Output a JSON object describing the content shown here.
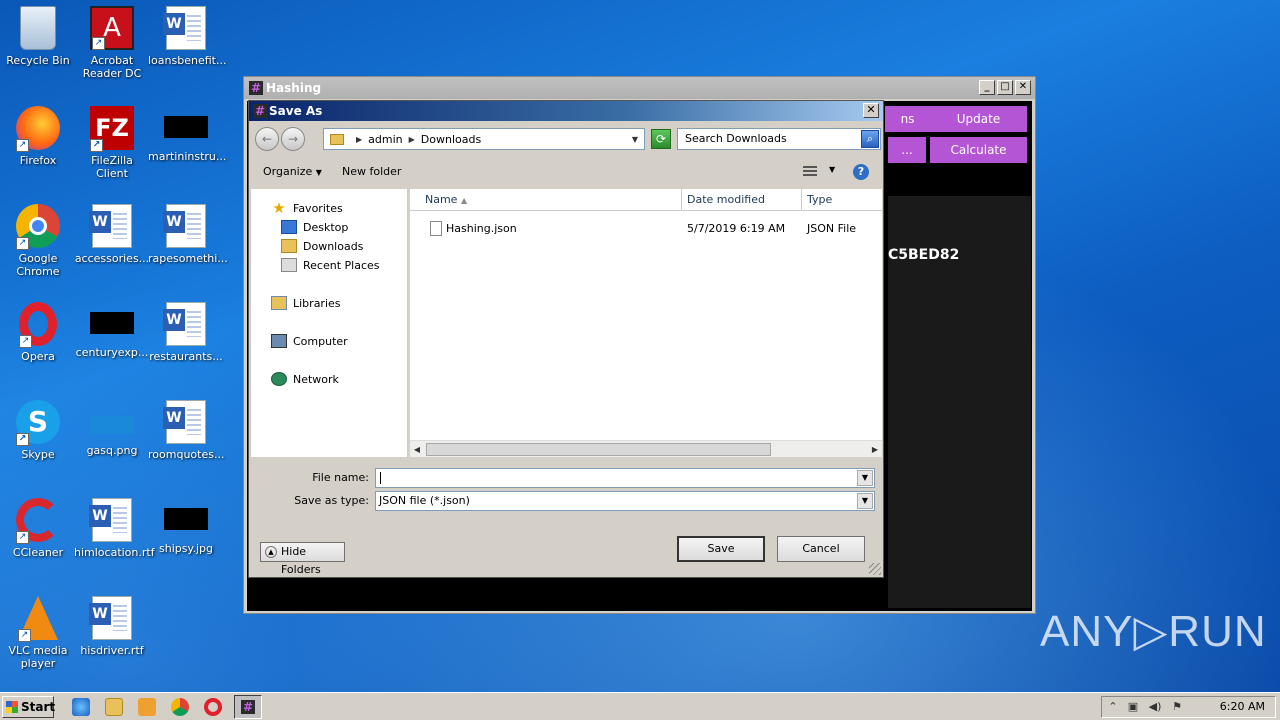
{
  "desktop": {
    "icons": [
      {
        "label": "Recycle Bin"
      },
      {
        "label": "Acrobat Reader DC"
      },
      {
        "label": "loansbenefit..."
      },
      {
        "label": "Firefox"
      },
      {
        "label": "FileZilla Client"
      },
      {
        "label": "martininstru..."
      },
      {
        "label": "Google Chrome"
      },
      {
        "label": "accessories..."
      },
      {
        "label": "rapesomethi..."
      },
      {
        "label": "Opera"
      },
      {
        "label": "centuryexp..."
      },
      {
        "label": "restaurants..."
      },
      {
        "label": "Skype"
      },
      {
        "label": "gasq.png"
      },
      {
        "label": "roomquotes..."
      },
      {
        "label": "CCleaner"
      },
      {
        "label": "himlocation.rtf"
      },
      {
        "label": "shipsy.jpg"
      },
      {
        "label": "VLC media player"
      },
      {
        "label": "hisdriver.rtf"
      }
    ],
    "watermark": "ANY▷RUN"
  },
  "app_window": {
    "title": "Hashing",
    "buttons": {
      "update": "Update",
      "calculate": "Calculate",
      "partial_top": "ns",
      "partial_ellipsis": "..."
    },
    "hash_text": "C5BED82"
  },
  "dialog": {
    "title": "Save As",
    "breadcrumb": {
      "part1": "admin",
      "part2": "Downloads"
    },
    "search_placeholder": "Search Downloads",
    "toolbar": {
      "organize": "Organize",
      "new_folder": "New folder"
    },
    "nav": {
      "favorites": "Favorites",
      "desktop": "Desktop",
      "downloads": "Downloads",
      "recent": "Recent Places",
      "libraries": "Libraries",
      "computer": "Computer",
      "network": "Network"
    },
    "columns": {
      "name": "Name",
      "date": "Date modified",
      "type": "Type"
    },
    "files": [
      {
        "name": "Hashing.json",
        "date": "5/7/2019 6:19 AM",
        "type": "JSON File"
      }
    ],
    "file_name_label": "File name:",
    "file_name_value": "",
    "save_type_label": "Save as type:",
    "save_type_value": "JSON file (*.json)",
    "hide_folders": "Hide Folders",
    "save": "Save",
    "cancel": "Cancel"
  },
  "taskbar": {
    "start": "Start",
    "clock": "6:20 AM"
  }
}
